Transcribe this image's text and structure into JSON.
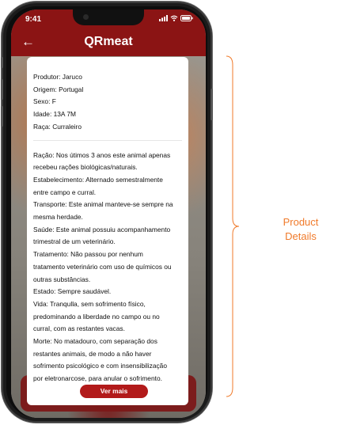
{
  "status_bar": {
    "time": "9:41"
  },
  "header": {
    "title": "QRmeat",
    "back_icon": "arrow-left-icon"
  },
  "product": {
    "basic": [
      "Produtor: Jaruco",
      "Origem: Portugal",
      "Sexo: F",
      "Idade: 13A 7M",
      "Raça: Curraleiro"
    ],
    "details": [
      "Ração: Nos útimos 3 anos este animal apenas",
      "recebeu rações biológicas/naturais.",
      "Estabelecimento: Alternado semestralmente",
      "entre campo e curral.",
      "Transporte: Este animal manteve-se sempre na",
      "mesma herdade.",
      "Saúde: Este animal possuiu acompanhamento",
      "trimestral de um veterinário.",
      "Tratamento: Não passou por nenhum",
      "tratamento veterinário com uso de químicos ou",
      "outras substâncias.",
      "Estado: Sempre saudável.",
      "Vida: Tranqulla, sem sofrimento físico,",
      "predominando a liberdade no campo ou no",
      "curral, com as restantes vacas.",
      "Morte: No matadouro, com separação dos",
      "restantes animais, de modo a não haver",
      "sofrimento psicológico e com insensibilização",
      "por eletronarcose, para anular o sofrimento."
    ],
    "more_button": "Ver mais"
  },
  "annotation": {
    "line1": "Product",
    "line2": "Details"
  },
  "colors": {
    "brand": "#8b1414",
    "button": "#b21a1a",
    "annotation": "#f07a2a"
  }
}
